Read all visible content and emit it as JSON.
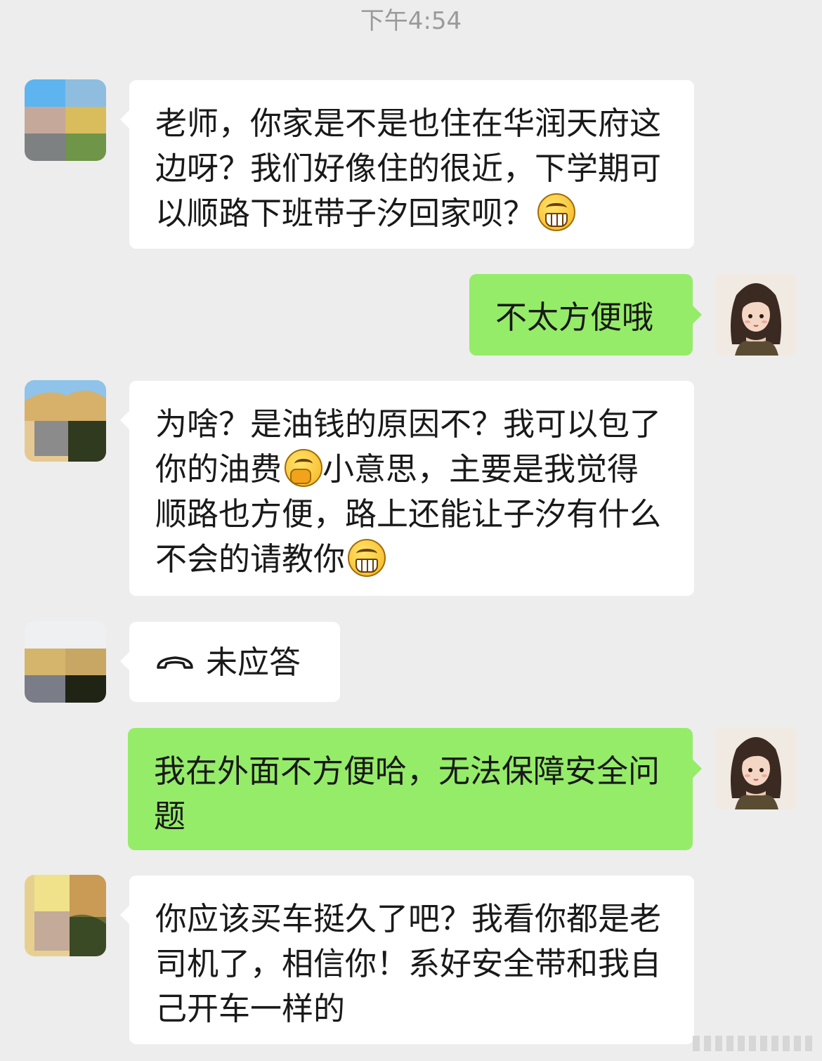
{
  "timestamp": "下午4:54",
  "messages": [
    {
      "from": "other",
      "text": "老师，你家是不是也住在华润天府这边呀？我们好像住的很近，下学期可以顺路下班带子汐回家呗？",
      "emoji_after": "grin-emoji"
    },
    {
      "from": "me",
      "text": "不太方便哦"
    },
    {
      "from": "other",
      "parts": [
        "为啥？是油钱的原因不？我可以包了你的油费",
        "小意思，主要是我觉得顺路也方便，路上还能让子汐有什么不会的请教你"
      ],
      "emojis": [
        "thinking-emoji",
        "grin-emoji"
      ]
    },
    {
      "from": "other",
      "type": "call",
      "text": "未应答",
      "icon": "phone-hangup-icon"
    },
    {
      "from": "me",
      "text": "我在外面不方便哈，无法保障安全问题"
    },
    {
      "from": "other",
      "text": "你应该买车挺久了吧？我看你都是老司机了，相信你！系好安全带和我自己开车一样的"
    }
  ],
  "colors": {
    "background": "#ededed",
    "incoming": "#ffffff",
    "outgoing": "#95ec69",
    "text": "#191919",
    "timestamp": "#9a9a9a"
  }
}
